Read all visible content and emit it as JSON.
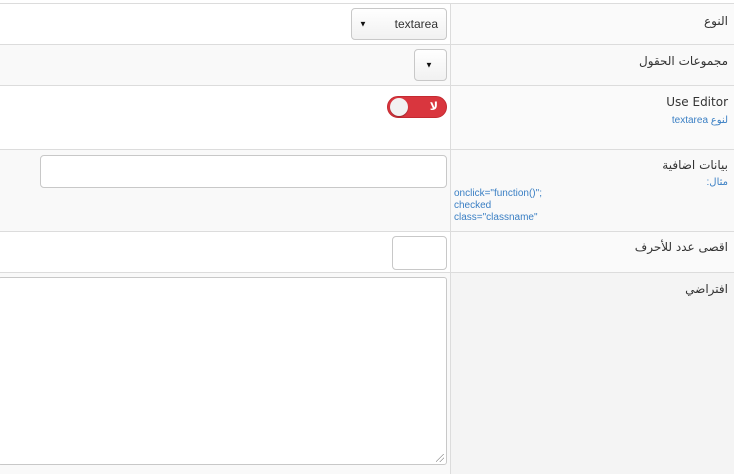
{
  "rows": {
    "type": {
      "label": "النوع",
      "select_value": "textarea"
    },
    "field_groups": {
      "label": "مجموعات الحقول",
      "select_value": ""
    },
    "use_editor": {
      "label": "Use Editor",
      "hint": "لنوع textarea",
      "toggle_text": "لا",
      "toggle_on": false
    },
    "extra_data": {
      "label": "بيانات اضافية",
      "hint_title": "مثال:",
      "hint_lines": "onclick=\"function()\";\nchecked\nclass=\"classname\"",
      "input_value": ""
    },
    "max_chars": {
      "label": "اقصى عدد للأحرف",
      "input_value": ""
    },
    "default": {
      "label": "افتراضي",
      "textarea_value": ""
    }
  },
  "icons": {
    "select_arrow": "triangle-down-icon",
    "resize_handle": "resize-grip-icon"
  },
  "colors": {
    "toggle_off": "#d9363e",
    "hint": "#3a7fc4",
    "border": "#dcdcdc"
  }
}
